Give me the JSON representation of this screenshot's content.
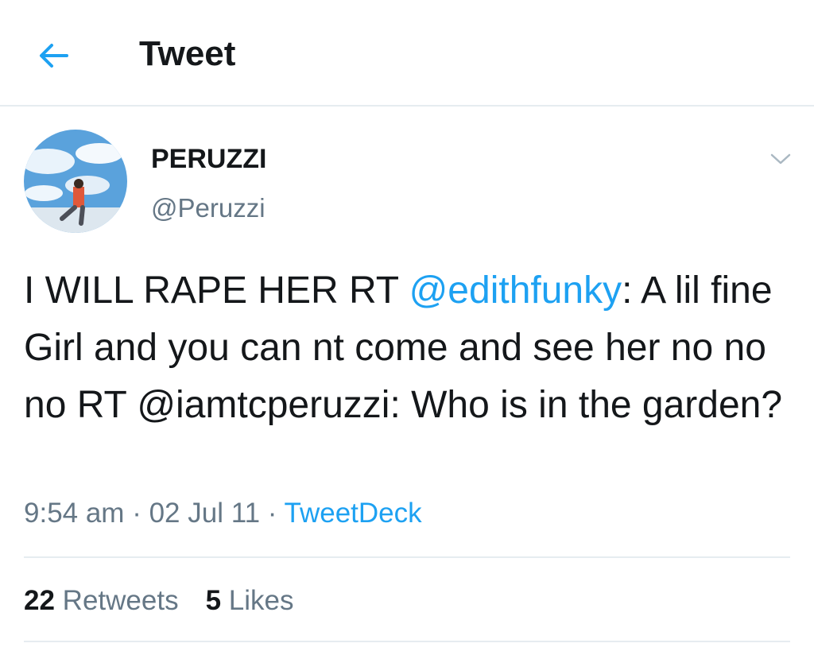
{
  "header": {
    "title": "Tweet",
    "back_icon": "arrow-left-icon"
  },
  "author": {
    "display_name": "PERUZZI",
    "handle": "@Peruzzi"
  },
  "tweet": {
    "text_parts": {
      "p1": "I WILL RAPE HER RT ",
      "mention1": "@edithfunky",
      "p2": ": A lil fine Girl and you can nt come and see her no no no RT @iamtcperuzzi: Who is in the garden?"
    },
    "time": "9:54 am",
    "sep1": " · ",
    "date": "02 Jul 11",
    "sep2": " · ",
    "source": "TweetDeck"
  },
  "stats": {
    "retweets_count": "22",
    "retweets_label": "Retweets",
    "likes_count": "5",
    "likes_label": "Likes"
  },
  "colors": {
    "accent": "#1da1f2",
    "secondary_text": "#657786",
    "divider": "#e6ecf0"
  }
}
